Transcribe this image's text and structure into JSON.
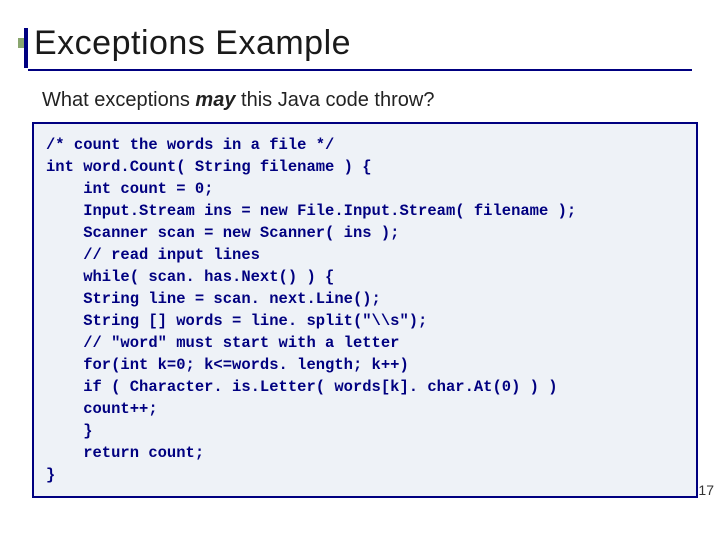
{
  "title": "Exceptions Example",
  "subtitle_prefix": "What exceptions ",
  "subtitle_em": "may",
  "subtitle_suffix": "  this Java code throw?",
  "code": "/* count the words in a file */\nint word.Count( String filename ) {\n    int count = 0;\n    Input.Stream ins = new File.Input.Stream( filename );\n    Scanner scan = new Scanner( ins );\n    // read input lines\n    while( scan. has.Next() ) {\n    String line = scan. next.Line();\n    String [] words = line. split(\"\\\\s\");\n    // \"word\" must start with a letter\n    for(int k=0; k<=words. length; k++)\n    if ( Character. is.Letter( words[k]. char.At(0) ) )\n    count++;\n    }\n    return count;\n}",
  "page_number": "17"
}
